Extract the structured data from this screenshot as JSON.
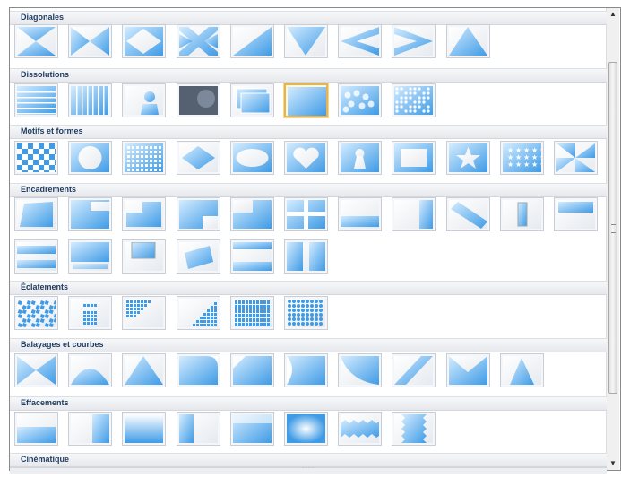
{
  "sections": [
    {
      "title": "Diagonales",
      "items": [
        "hourglass-h",
        "bowtie",
        "diamond-out",
        "cross-x",
        "tri-lr",
        "v-down",
        "arrow-left",
        "arrow-right",
        "tri-up"
      ]
    },
    {
      "title": "Dissolutions",
      "items": [
        "stripes-h",
        "stripes-v",
        "person",
        "dark-fade",
        "layered",
        "plain",
        "blobs",
        "dots"
      ]
    },
    {
      "title": "Motifs et formes",
      "items": [
        "checker",
        "circle",
        "grid",
        "diamond",
        "ellipse",
        "heart",
        "keyhole",
        "rect",
        "star",
        "stars",
        "pinwheel"
      ]
    },
    {
      "title": "Encadrements",
      "items": [
        "frame-slant",
        "frame-l",
        "frame-step",
        "frame-step2",
        "frame-corner",
        "frame-plus",
        "frame-band",
        "frame-right",
        "frame-diag",
        "frame-slot",
        "frame-top",
        "frame-lines",
        "frame-bottom",
        "frame-inset",
        "frame-tilted",
        "frame-hband",
        "frame-split"
      ]
    },
    {
      "title": "Éclatements",
      "items": [
        "shatter",
        "burst",
        "scatter-tl",
        "scatter-tr",
        "tiles",
        "rounded-tiles"
      ]
    },
    {
      "title": "Balayages et courbes",
      "items": [
        "sweep-hourglass",
        "sweep-arc",
        "sweep-peak",
        "sweep-curl",
        "sweep-corner",
        "sweep-fold",
        "sweep-curve",
        "sweep-diag",
        "sweep-envelope",
        "sweep-triangle"
      ]
    },
    {
      "title": "Effacements",
      "items": [
        "wipe-bottom",
        "wipe-right",
        "wipe-soft",
        "wipe-left",
        "wipe-fade",
        "wipe-radial",
        "wipe-zigzag",
        "wipe-jagged"
      ]
    },
    {
      "title": "Cinématique",
      "items": []
    }
  ],
  "selected": {
    "section": 1,
    "item": 5
  },
  "colors": {
    "accent": "#3f9be6",
    "light": "#d4ecff",
    "selected_border": "#e7b452"
  },
  "scrollbar": {
    "up_icon": "▲",
    "down_icon": "▼",
    "grip": "∙∙∙∙"
  }
}
